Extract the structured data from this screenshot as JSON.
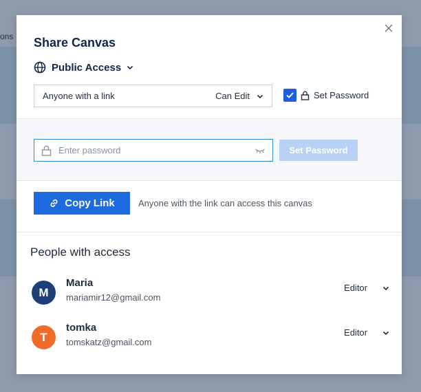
{
  "background": {
    "partial_text": "ons"
  },
  "modal": {
    "title": "Share Canvas",
    "access_mode": "Public Access",
    "link_scope": "Anyone with a link",
    "link_permission": "Can Edit",
    "set_password_label": "Set Password",
    "set_password_checked": true
  },
  "password": {
    "placeholder": "Enter password",
    "value": "",
    "button_label": "Set Password"
  },
  "copy": {
    "button_label": "Copy Link",
    "note": "Anyone with the link can access this canvas"
  },
  "people": {
    "title": "People with access",
    "list": [
      {
        "initial": "M",
        "name": "Maria",
        "email": "mariamir12@gmail.com",
        "role": "Editor",
        "color": "#1c3f7a"
      },
      {
        "initial": "T",
        "name": "tomka",
        "email": "tomskatz@gmail.com",
        "role": "Editor",
        "color": "#f06a2a"
      }
    ]
  },
  "colors": {
    "accent": "#1d6be0",
    "focus": "#2b8fd6",
    "disabled_button": "#b8d1f7"
  }
}
